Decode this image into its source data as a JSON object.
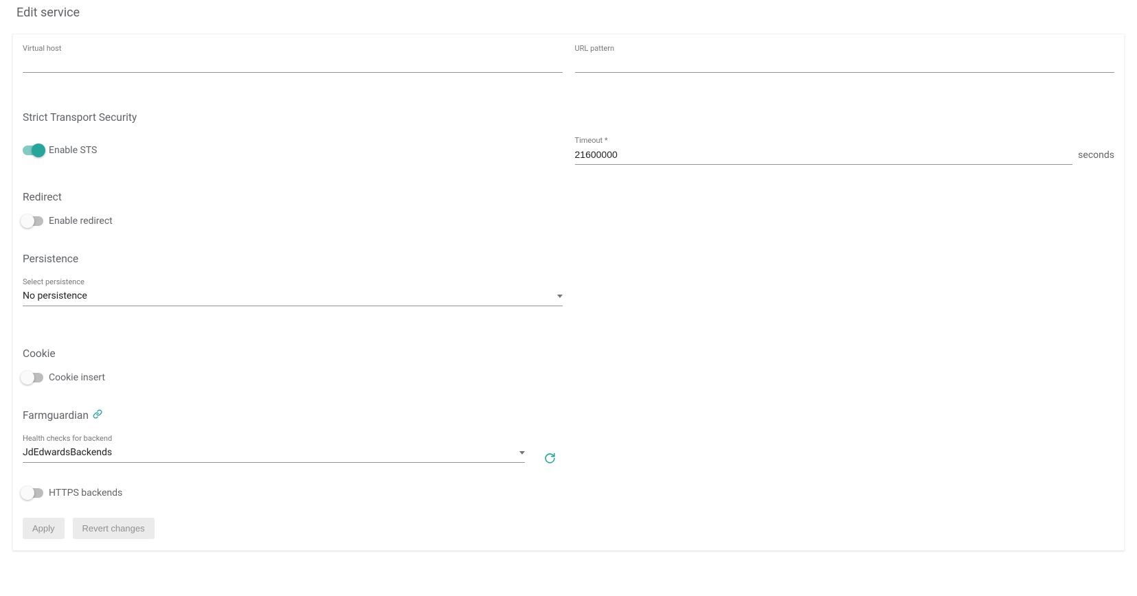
{
  "page": {
    "title": "Edit service"
  },
  "top": {
    "virtual_host_label": "Virtual host",
    "virtual_host_value": "",
    "url_pattern_label": "URL pattern",
    "url_pattern_value": ""
  },
  "sts": {
    "heading": "Strict Transport Security",
    "toggle_label": "Enable STS",
    "toggle_on": true,
    "timeout_label": "Timeout *",
    "timeout_value": "21600000",
    "timeout_unit": "seconds"
  },
  "redirect": {
    "heading": "Redirect",
    "toggle_label": "Enable redirect",
    "toggle_on": false
  },
  "persistence": {
    "heading": "Persistence",
    "select_label": "Select persistence",
    "select_value": "No persistence"
  },
  "cookie": {
    "heading": "Cookie",
    "toggle_label": "Cookie insert",
    "toggle_on": false
  },
  "farmguardian": {
    "heading": "Farmguardian",
    "select_label": "Health checks for backend",
    "select_value": "JdEdwardsBackends"
  },
  "https_backends": {
    "toggle_label": "HTTPS backends",
    "toggle_on": false
  },
  "buttons": {
    "apply": "Apply",
    "revert": "Revert changes"
  }
}
